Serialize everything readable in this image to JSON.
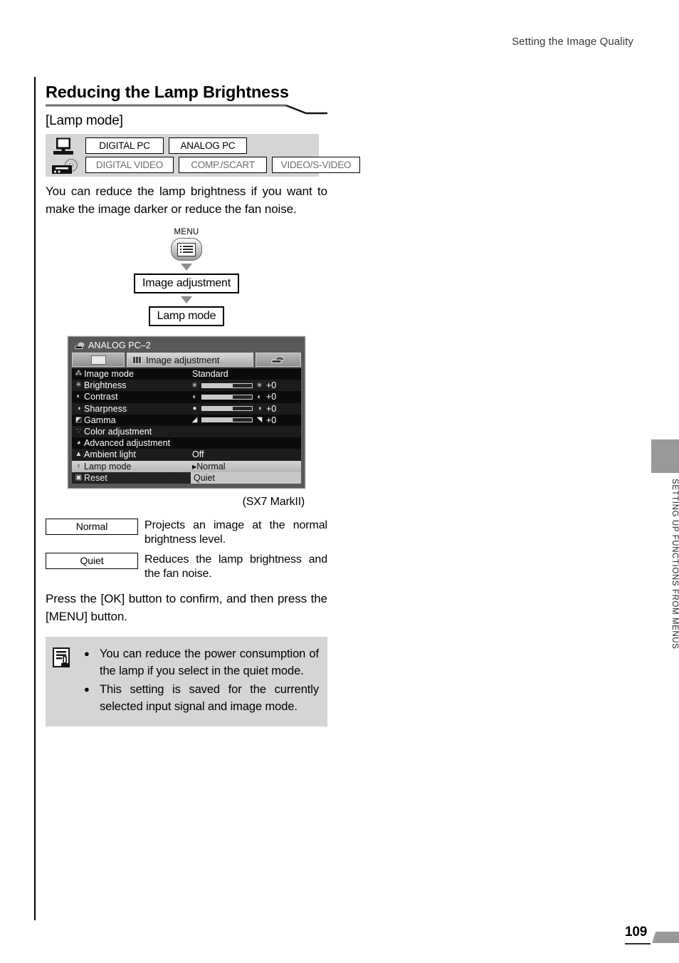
{
  "header": {
    "running_head": "Setting the Image Quality"
  },
  "section": {
    "title": "Reducing the Lamp Brightness",
    "subtitle": "[Lamp mode]"
  },
  "signal_table": {
    "icons": [
      "computer-monitor-icon",
      "video-deck-icon"
    ],
    "row1": [
      {
        "label": "DIGITAL PC",
        "enabled": true
      },
      {
        "label": "ANALOG PC",
        "enabled": true
      }
    ],
    "row2": [
      {
        "label": "DIGITAL VIDEO",
        "enabled": false
      },
      {
        "label": "COMP./SCART",
        "enabled": false
      },
      {
        "label": "VIDEO/S-VIDEO",
        "enabled": false
      }
    ]
  },
  "intro": "You can reduce the lamp brightness if you want to make the image darker or reduce the fan noise.",
  "flow": {
    "menu_label": "MENU",
    "step1": "Image adjustment",
    "step2": "Lamp mode"
  },
  "osd": {
    "signal_title": "ANALOG PC–2",
    "tab_middle": "Image adjustment",
    "rows": [
      {
        "icon": "image-mode-icon",
        "glyph": "⁂",
        "name": "Image mode",
        "value": "Standard",
        "kind": "text"
      },
      {
        "icon": "brightness-icon",
        "glyph": "✳",
        "name": "Brightness",
        "value": "+0",
        "kind": "slider",
        "fill": 62
      },
      {
        "icon": "contrast-icon",
        "glyph": "◐",
        "name": "Contrast",
        "value": "+0",
        "kind": "slider",
        "fill": 62
      },
      {
        "icon": "sharpness-icon",
        "glyph": "◑",
        "name": "Sharpness",
        "value": "+0",
        "kind": "slider",
        "fill": 62
      },
      {
        "icon": "gamma-icon",
        "glyph": "◩",
        "name": "Gamma",
        "value": "+0",
        "kind": "slider",
        "fill": 62
      },
      {
        "icon": "color-adjustment-icon",
        "glyph": "∵",
        "name": "Color adjustment",
        "value": "",
        "kind": "none"
      },
      {
        "icon": "advanced-adjustment-icon",
        "glyph": "◕",
        "name": "Advanced adjustment",
        "value": "",
        "kind": "none"
      },
      {
        "icon": "ambient-light-icon",
        "glyph": "▲",
        "name": "Ambient light",
        "value": "Off",
        "kind": "text"
      },
      {
        "icon": "lamp-mode-icon",
        "glyph": "♀",
        "name": "Lamp mode",
        "value": "▸Normal",
        "kind": "text",
        "highlighted": true
      },
      {
        "icon": "reset-icon",
        "glyph": "▣",
        "name": "Reset",
        "value": "Quiet",
        "kind": "text",
        "submenu": true
      }
    ],
    "caption": "(SX7 MarkII)"
  },
  "options": [
    {
      "name": "Normal",
      "description": "Projects an image at the normal brightness level."
    },
    {
      "name": "Quiet",
      "description": "Reduces the lamp brightness and the fan noise."
    }
  ],
  "confirm_text": "Press the [OK] button to confirm, and then press the [MENU] button.",
  "note": {
    "icon": "memo-pencil-icon",
    "bullet": "●",
    "items": [
      "You can reduce the power consumption of the lamp if you select in the quiet mode.",
      "This setting is saved for the currently selected input signal and image mode."
    ]
  },
  "side_tab": {
    "label": "SETTING UP FUNCTIONS FROM MENUS"
  },
  "footer": {
    "page_number": "109"
  },
  "colors": {
    "gray_band": "#d5d5d5",
    "side_tab": "#999999",
    "osd_bg": "#58585a"
  }
}
